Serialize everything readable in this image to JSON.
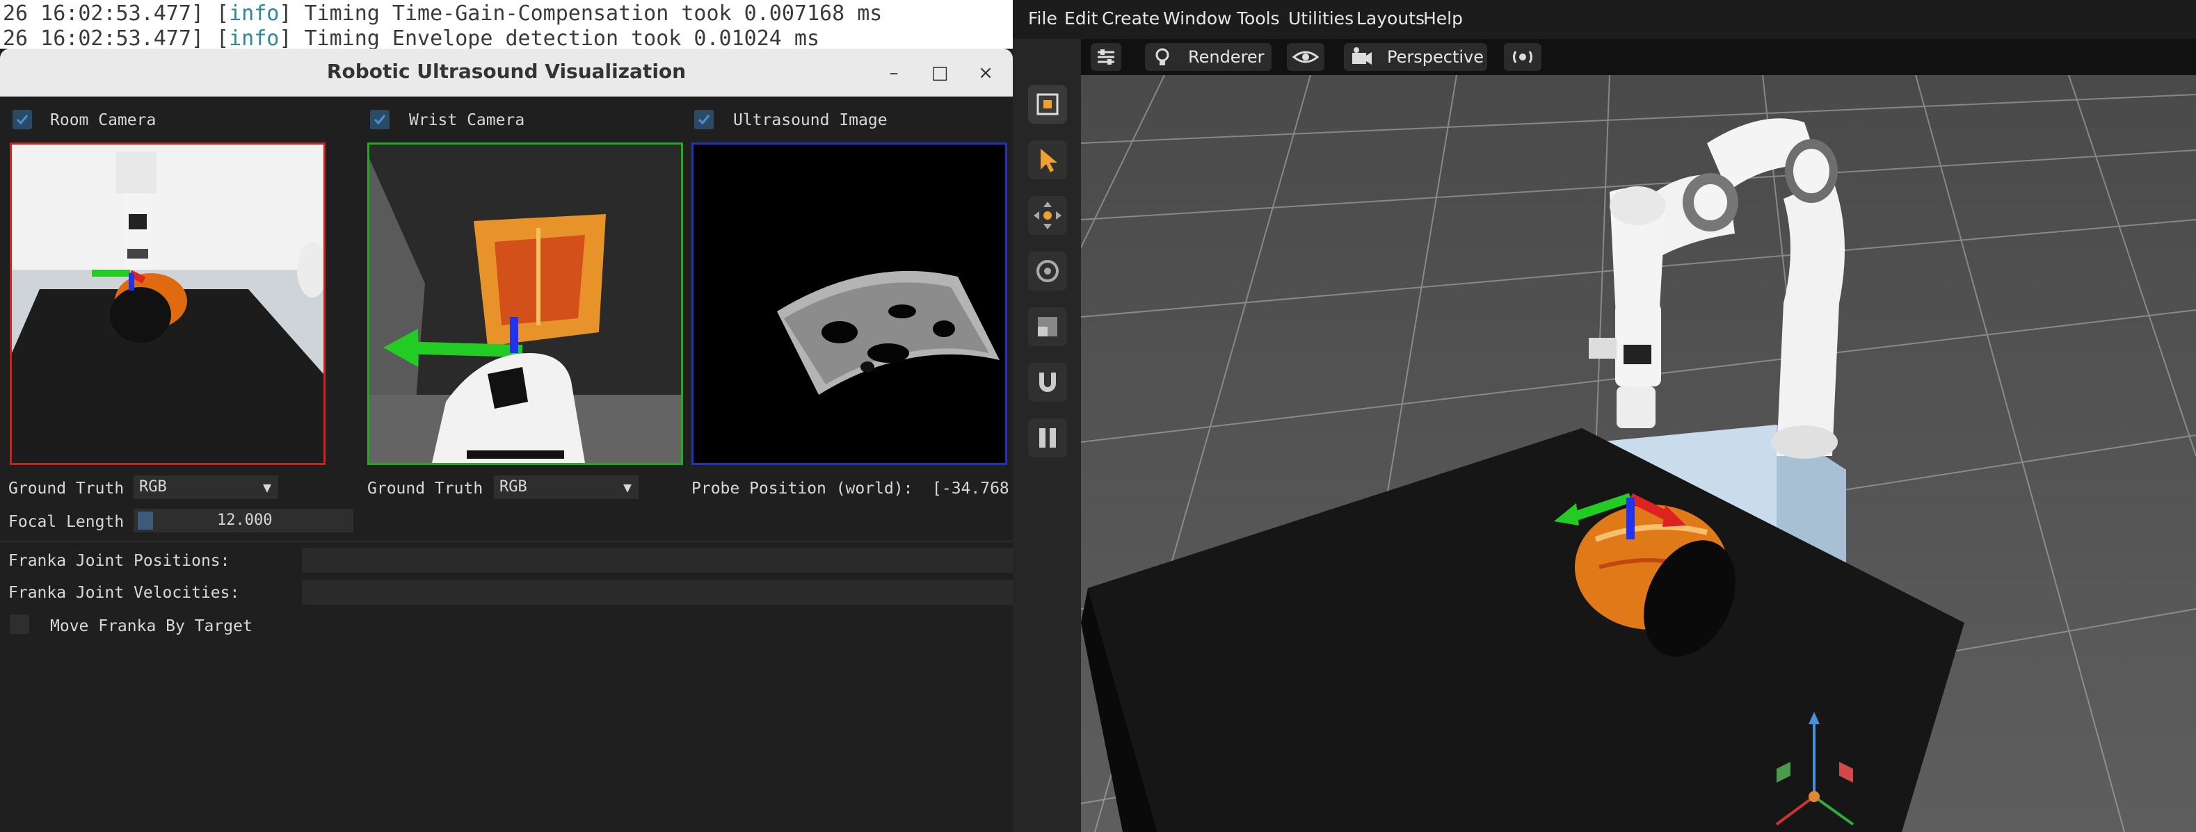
{
  "terminal": {
    "lines": [
      {
        "prefix": "26 16:02:53.477] [",
        "level": "info",
        "suffix": "] Timing Time-Gain-Compensation took 0.007168 ms"
      },
      {
        "prefix": "26 16:02:53.477] [",
        "level": "info",
        "suffix": "] Timing Envelope detection took 0.01024 ms"
      }
    ]
  },
  "viz_window": {
    "title": "Robotic Ultrasound Visualization",
    "controls": {
      "minimize": "–",
      "maximize": "□",
      "close": "×"
    },
    "panels": [
      {
        "label": "Room Camera",
        "checked": true,
        "border_color": "#cc2222"
      },
      {
        "label": "Wrist Camera",
        "checked": true,
        "border_color": "#22aa22"
      },
      {
        "label": "Ultrasound Image",
        "checked": true,
        "border_color": "#2233bb"
      }
    ],
    "room_gt_label": "Ground Truth",
    "room_gt_value": "RGB",
    "wrist_gt_label": "Ground Truth",
    "wrist_gt_value": "RGB",
    "probe_label": "Probe Position (world):",
    "probe_value": "[-34.768",
    "focal_label": "Focal Length",
    "focal_value": "12.000",
    "joint_positions_label": "Franka Joint Positions:",
    "joint_velocities_label": "Franka Joint Velocities:",
    "move_label": "Move Franka By Target",
    "move_checked": false,
    "dropdown_arrow": "▼"
  },
  "app": {
    "menu": [
      "File",
      "Edit",
      "Create",
      "Window",
      "Tools",
      "Utilities",
      "Layouts",
      "Help"
    ],
    "viewport_toolbar": {
      "renderer_label": "Renderer",
      "camera_label": "Perspective"
    },
    "left_toolbar_icons": [
      "cube-icon",
      "select-arrow-icon",
      "move-icon",
      "rotate-icon",
      "scale-icon",
      "snap-magnet-icon",
      "pause-icon"
    ],
    "accent_color": "#f0a030"
  }
}
